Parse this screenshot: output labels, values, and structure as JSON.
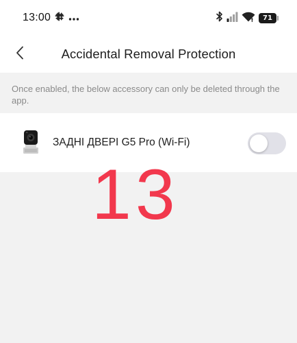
{
  "status_bar": {
    "time": "13:00",
    "battery_level": "71"
  },
  "header": {
    "title": "Accidental Removal Protection"
  },
  "info": {
    "text": "Once enabled, the below accessory can only be deleted through the app."
  },
  "device": {
    "name": "ЗАДНІ ДВЕРІ G5 Pro (Wi-Fi)",
    "toggle_state": "off"
  },
  "overlay": {
    "label": "13",
    "color": "#f2384d"
  },
  "icons": {
    "back": "chevron-left-icon",
    "slack": "slack-icon",
    "more": "more-dots-icon",
    "bluetooth": "bluetooth-icon",
    "signal": "signal-icon",
    "wifi": "wifi-icon",
    "battery": "battery-icon",
    "camera": "camera-icon"
  },
  "colors": {
    "background": "#f2f2f2",
    "surface": "#ffffff",
    "muted_text": "#8a8a8a",
    "toggle_off": "#e1e1e8"
  }
}
